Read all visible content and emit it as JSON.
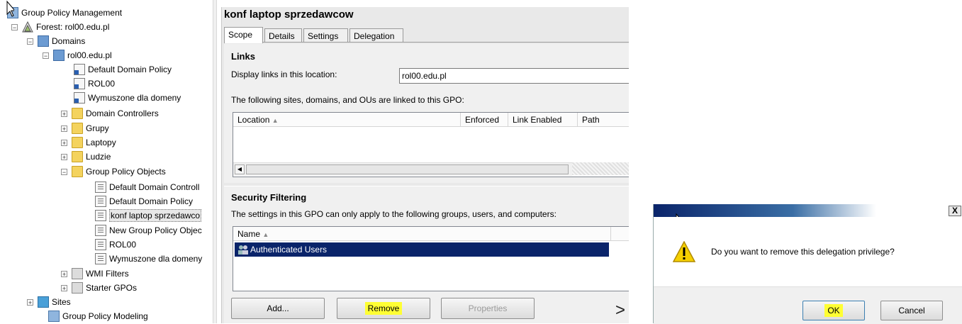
{
  "tree": {
    "root": "Group Policy Management",
    "forest": "Forest: rol00.edu.pl",
    "domains": "Domains",
    "domain": "rol00.edu.pl",
    "default_domain_policy": "Default Domain Policy",
    "rol00": "ROL00",
    "wymuszone": "Wymuszone dla domeny",
    "domain_controllers": "Domain Controllers",
    "grupy": "Grupy",
    "laptopy": "Laptopy",
    "ludzie": "Ludzie",
    "gpo_container": "Group Policy Objects",
    "gpo_items": [
      "Default Domain Controll",
      "Default Domain Policy",
      "konf laptop sprzedawco",
      "New Group Policy Objec",
      "ROL00",
      "Wymuszone dla domeny"
    ],
    "wmi_filters": "WMI Filters",
    "starter_gpos": "Starter GPOs",
    "sites": "Sites",
    "modeling": "Group Policy Modeling"
  },
  "gpo": {
    "title": "konf laptop sprzedawcow",
    "tabs": [
      "Scope",
      "Details",
      "Settings",
      "Delegation"
    ],
    "links": {
      "heading": "Links",
      "display_label": "Display links in this location:",
      "display_value": "rol00.edu.pl",
      "linked_text": "The following sites, domains, and OUs are linked to this GPO:",
      "columns": [
        "Location",
        "Enforced",
        "Link Enabled",
        "Path"
      ]
    },
    "security": {
      "heading": "Security Filtering",
      "desc": "The settings in this GPO can only apply to the following groups, users, and computers:",
      "column": "Name",
      "rows": [
        "Authenticated Users"
      ]
    },
    "buttons": {
      "add": "Add...",
      "remove": "Remove",
      "properties": "Properties"
    }
  },
  "separator": ">",
  "dialog": {
    "close": "X",
    "message": "Do you want to remove this delegation privilege?",
    "ok": "OK",
    "cancel": "Cancel"
  },
  "colors": {
    "highlight": "#ffff33",
    "selection": "#0a246a"
  }
}
